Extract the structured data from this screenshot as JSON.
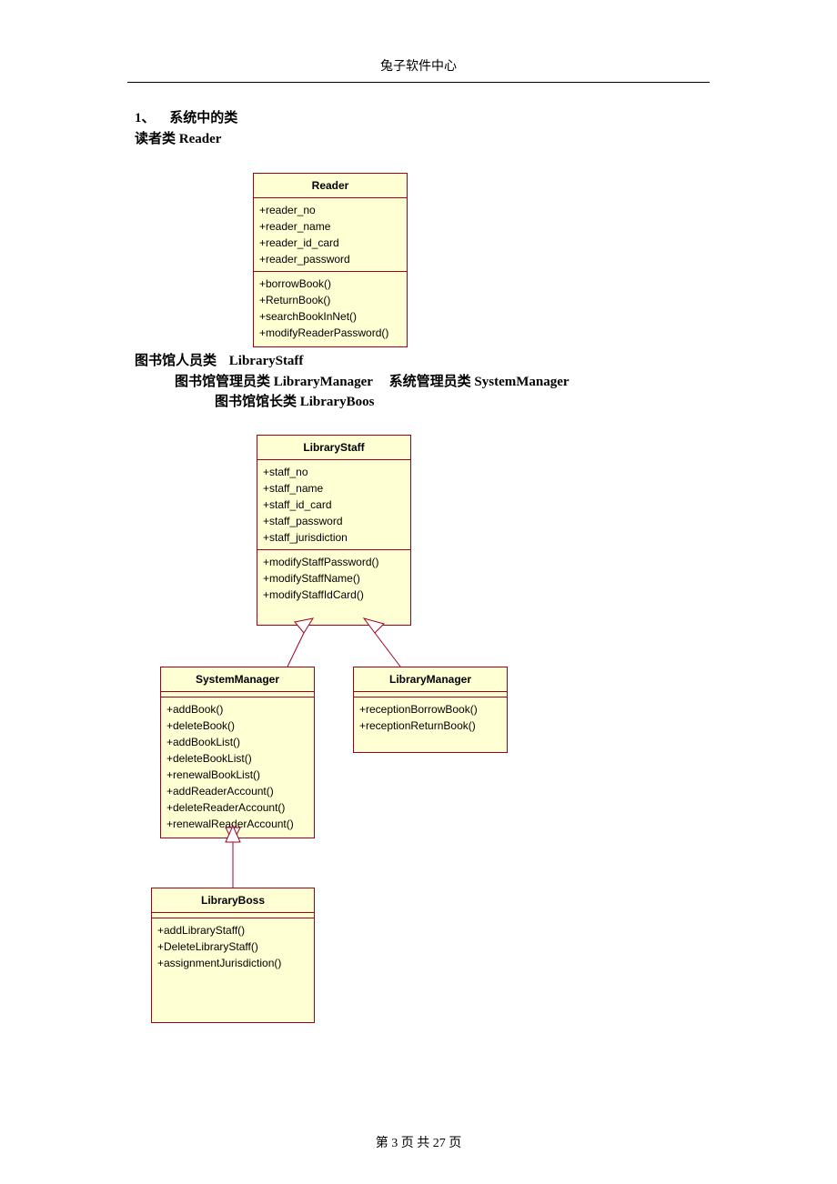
{
  "header": {
    "center": "兔子软件中心"
  },
  "text": {
    "sec1_num": "1、",
    "sec1_title": "系统中的类",
    "reader_line": "读者类 Reader",
    "staff_line_pre": "图书馆人员类",
    "staff_line_cls": "LibraryStaff",
    "lm_line_pre": "图书馆管理员类 LibraryManager",
    "sm_line_pre": "系统管理员类 SystemManager",
    "boss_line": "图书馆馆长类 LibraryBoos"
  },
  "footer": {
    "page_label": "第 3 页 共 27 页",
    "page_current": 3,
    "page_total": 27
  },
  "uml": {
    "Reader": {
      "title": "Reader",
      "attrs": [
        "+reader_no",
        "+reader_name",
        "+reader_id_card",
        "+reader_password"
      ],
      "ops": [
        "+borrowBook()",
        "+ReturnBook()",
        "+searchBookInNet()",
        "+modifyReaderPassword()"
      ]
    },
    "LibraryStaff": {
      "title": "LibraryStaff",
      "attrs": [
        "+staff_no",
        "+staff_name",
        "+staff_id_card",
        "+staff_password",
        "+staff_jurisdiction"
      ],
      "ops": [
        "+modifyStaffPassword()",
        "+modifyStaffName()",
        "+modifyStaffIdCard()"
      ]
    },
    "SystemManager": {
      "title": "SystemManager",
      "attrs_empty": true,
      "ops": [
        "+addBook()",
        "+deleteBook()",
        "+addBookList()",
        "+deleteBookList()",
        "+renewalBookList()",
        "+addReaderAccount()",
        "+deleteReaderAccount()",
        "+renewalReaderAccount()"
      ]
    },
    "LibraryManager": {
      "title": "LibraryManager",
      "attrs_empty": true,
      "ops": [
        "+receptionBorrowBook()",
        "+receptionReturnBook()"
      ]
    },
    "LibraryBoss": {
      "title": "LibraryBoss",
      "attrs_empty": true,
      "ops": [
        "+addLibraryStaff()",
        "+DeleteLibraryStaff()",
        "+assignmentJurisdiction()"
      ]
    }
  },
  "relations": [
    {
      "child": "SystemManager",
      "parent": "LibraryStaff",
      "type": "generalization"
    },
    {
      "child": "LibraryManager",
      "parent": "LibraryStaff",
      "type": "generalization"
    },
    {
      "child": "LibraryBoss",
      "parent": "SystemManager",
      "type": "generalization"
    }
  ],
  "chart_data": {
    "type": "uml_class_diagram",
    "classes": [
      {
        "name": "Reader",
        "attrs": [
          "reader_no",
          "reader_name",
          "reader_id_card",
          "reader_password"
        ],
        "ops": [
          "borrowBook()",
          "ReturnBook()",
          "searchBookInNet()",
          "modifyReaderPassword()"
        ]
      },
      {
        "name": "LibraryStaff",
        "attrs": [
          "staff_no",
          "staff_name",
          "staff_id_card",
          "staff_password",
          "staff_jurisdiction"
        ],
        "ops": [
          "modifyStaffPassword()",
          "modifyStaffName()",
          "modifyStaffIdCard()"
        ]
      },
      {
        "name": "SystemManager",
        "ops": [
          "addBook()",
          "deleteBook()",
          "addBookList()",
          "deleteBookList()",
          "renewalBookList()",
          "addReaderAccount()",
          "deleteReaderAccount()",
          "renewalReaderAccount()"
        ]
      },
      {
        "name": "LibraryManager",
        "ops": [
          "receptionBorrowBook()",
          "receptionReturnBook()"
        ]
      },
      {
        "name": "LibraryBoss",
        "ops": [
          "addLibraryStaff()",
          "DeleteLibraryStaff()",
          "assignmentJurisdiction()"
        ]
      }
    ],
    "generalizations": [
      {
        "child": "SystemManager",
        "parent": "LibraryStaff"
      },
      {
        "child": "LibraryManager",
        "parent": "LibraryStaff"
      },
      {
        "child": "LibraryBoss",
        "parent": "SystemManager"
      }
    ]
  }
}
